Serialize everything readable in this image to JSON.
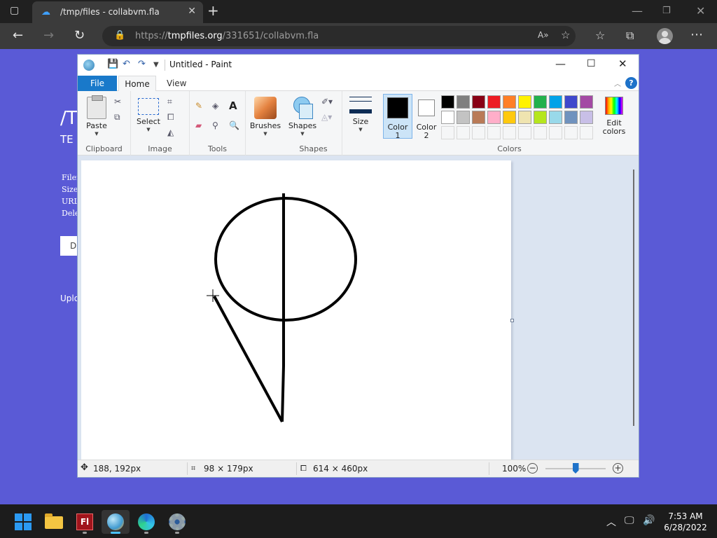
{
  "browser": {
    "tab_title": "/tmp/files - collabvm.fla",
    "url_prefix": "https://",
    "url_host": "tmpfiles.org",
    "url_path": "/331651/collabvm.fla"
  },
  "webpage": {
    "title_partial": "/T",
    "subtitle_partial": "TE",
    "lines_partial": [
      "Filen",
      "Size",
      "URL",
      "Dele"
    ],
    "button_partial": "D",
    "upload_partial": "Uplo"
  },
  "paint": {
    "window_title": "Untitled - Paint",
    "tabs": {
      "file": "File",
      "home": "Home",
      "view": "View"
    },
    "help": "?",
    "ribbon": {
      "paste": "Paste",
      "select": "Select",
      "brushes": "Brushes",
      "shapes": "Shapes",
      "size": "Size",
      "color1": [
        "Color",
        "1"
      ],
      "color2": [
        "Color",
        "2"
      ],
      "edit_colors": [
        "Edit",
        "colors"
      ],
      "groups": [
        "Clipboard",
        "Image",
        "Tools",
        "Shapes",
        "Colors"
      ]
    },
    "palette_row1": [
      "#000000",
      "#7f7f7f",
      "#880015",
      "#ed1c24",
      "#ff7f27",
      "#fff200",
      "#22b14c",
      "#00a2e8",
      "#3f48cc",
      "#a349a4"
    ],
    "palette_row2": [
      "#ffffff",
      "#c3c3c3",
      "#b97a57",
      "#ffaec9",
      "#ffc90e",
      "#efe4b0",
      "#b5e61d",
      "#99d9ea",
      "#7092be",
      "#c8bfe7"
    ],
    "status": {
      "cursor_pos": "188, 192px",
      "selection_size": "98 × 179px",
      "canvas_size": "614 × 460px",
      "zoom": "100%",
      "zoom_percent": 100
    }
  },
  "taskbar": {
    "time": "7:53 AM",
    "date": "6/28/2022",
    "flash_label": "Fl"
  }
}
